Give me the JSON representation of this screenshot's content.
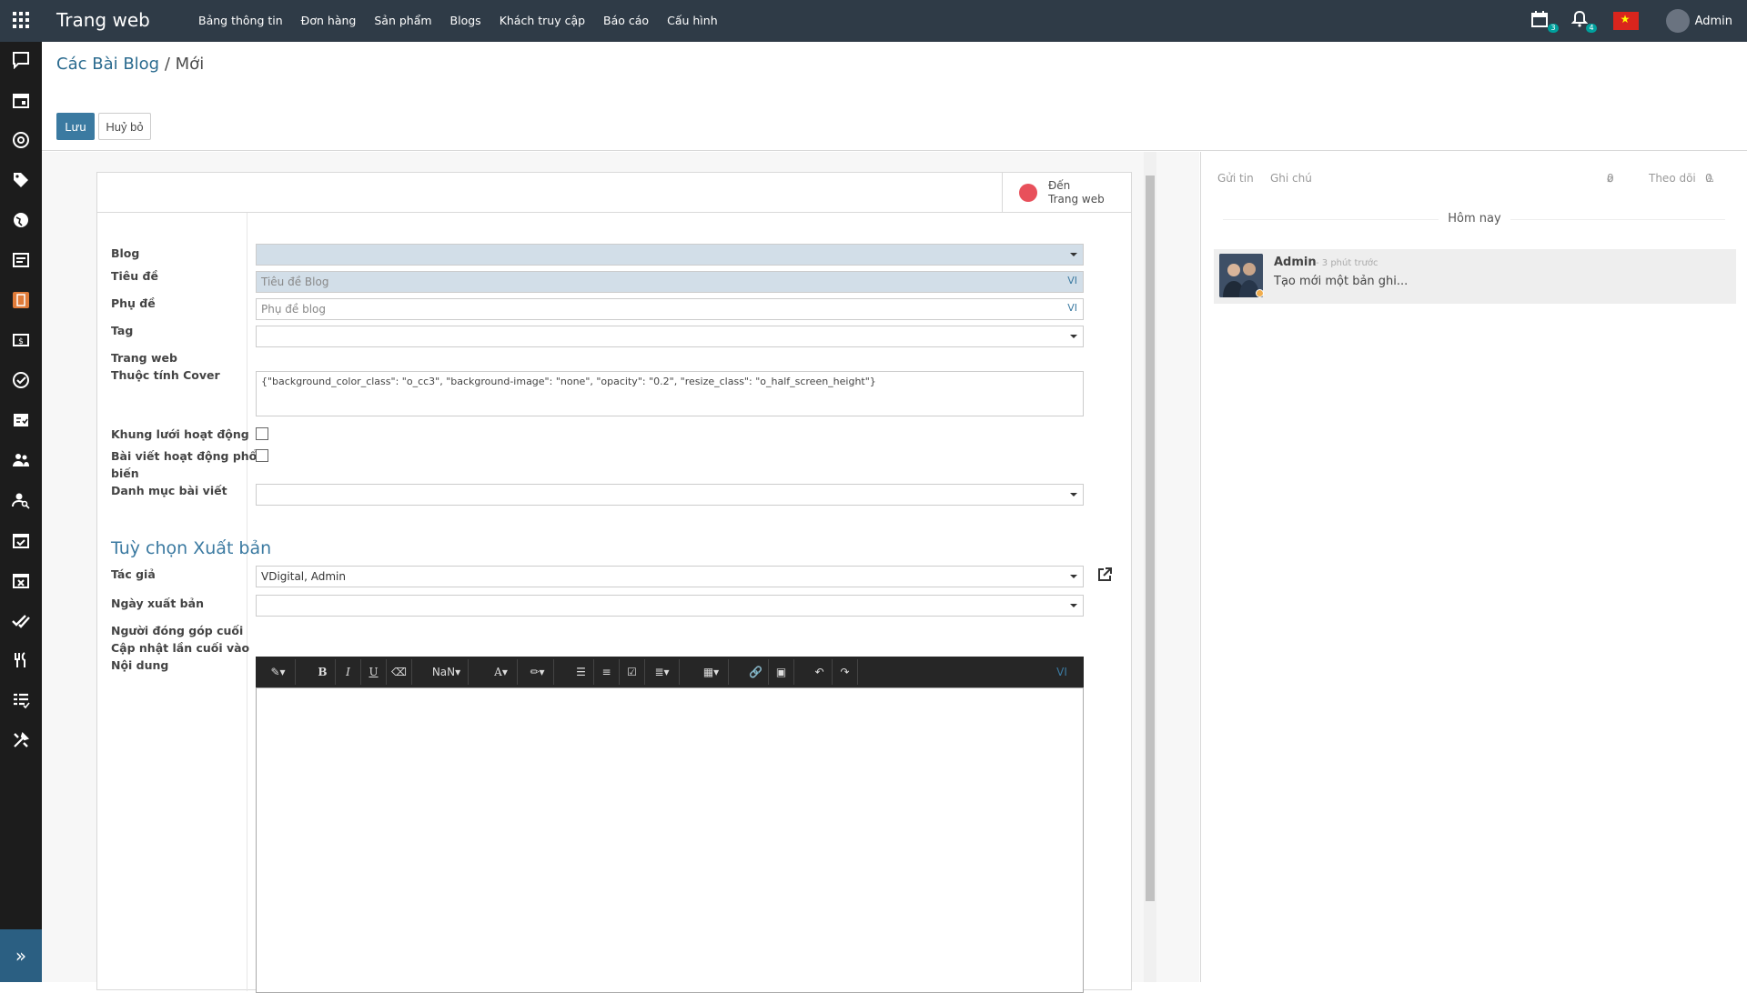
{
  "navbar": {
    "brand": "Trang web",
    "menu": [
      "Bảng thông tin",
      "Đơn hàng",
      "Sản phẩm",
      "Blogs",
      "Khách truy cập",
      "Báo cáo",
      "Cấu hình"
    ],
    "activity_count": "3",
    "notification_count": "4",
    "user": "Admin"
  },
  "breadcrumb": {
    "parent": "Các Bài Blog",
    "separator": "/",
    "current": "Mới"
  },
  "buttons": {
    "save": "Lưu",
    "discard": "Huỷ bỏ"
  },
  "smart_button": {
    "line1": "Đến",
    "line2": "Trang web"
  },
  "form": {
    "blog_label": "Blog",
    "title_label": "Tiêu đề",
    "title_placeholder": "Tiêu đề Blog",
    "subtitle_label": "Phụ đề",
    "subtitle_placeholder": "Phụ đề blog",
    "tag_label": "Tag",
    "cover_label_1": "Trang web",
    "cover_label_2": "Thuộc tính Cover",
    "cover_value": "{\"background_color_class\": \"o_cc3\", \"background-image\": \"none\", \"opacity\": \"0.2\", \"resize_class\": \"o_half_screen_height\"}",
    "grid_label": "Khung lưới hoạt động",
    "popular_label_1": "Bài viết hoạt động phổ",
    "popular_label_2": "biến",
    "category_label": "Danh mục bài viết",
    "lang": "VI",
    "section_title": "Tuỳ chọn Xuất bản",
    "author_label": "Tác giả",
    "author_value": "VDigital, Admin",
    "publish_date_label": "Ngày xuất bản",
    "contributor_label": "Người đóng góp cuối",
    "updated_label": "Cập nhật lần cuối vào",
    "content_label": "Nội dung"
  },
  "editor_toolbar": {
    "font_size": "NaN",
    "bold": "B",
    "italic": "I",
    "underline": "U",
    "font_color": "A",
    "lang": "VI"
  },
  "chatter": {
    "send_message": "Gửi tin",
    "log_note": "Ghi chú",
    "attachments": "0",
    "follow": "Theo dõi",
    "followers": "0",
    "date_separator": "Hôm nay",
    "message": {
      "author": "Admin",
      "time": "- 3 phút trước",
      "body": "Tạo mới một bản ghi..."
    }
  },
  "colors": {
    "navbar": "#2f3b47",
    "sidebar": "#1c1c1c",
    "accent": "#3b7aa1",
    "highlight_field": "#d2dee8"
  }
}
